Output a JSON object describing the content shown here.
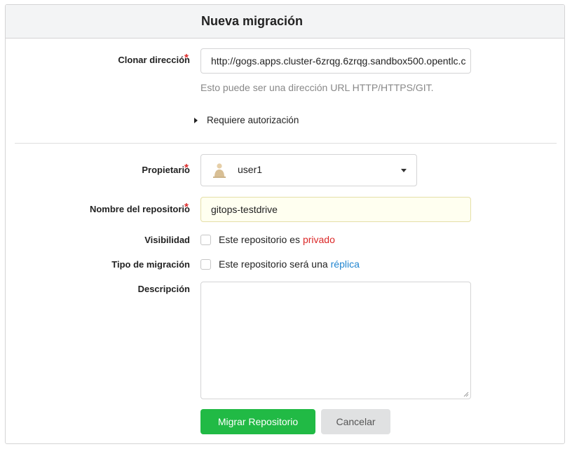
{
  "header": {
    "title": "Nueva migración"
  },
  "form": {
    "clone": {
      "label": "Clonar dirección",
      "required_mark": "*",
      "value": "http://gogs.apps.cluster-6zrqg.6zrqg.sandbox500.opentlc.c",
      "help": "Esto puede ser una dirección URL HTTP/HTTPS/GIT."
    },
    "auth_toggle": "Requiere autorización",
    "owner": {
      "label": "Propietario",
      "required_mark": "*",
      "value": "user1"
    },
    "repo_name": {
      "label": "Nombre del repositorio",
      "required_mark": "*",
      "value": "gitops-testdrive"
    },
    "visibility": {
      "label": "Visibilidad",
      "text": "Este repositorio es",
      "highlight": "privado",
      "checked": false
    },
    "migration_type": {
      "label": "Tipo de migración",
      "text": "Este repositorio será una",
      "highlight": "réplica",
      "checked": false
    },
    "description": {
      "label": "Descripción",
      "value": ""
    }
  },
  "buttons": {
    "submit": "Migrar Repositorio",
    "cancel": "Cancelar"
  },
  "colors": {
    "accent_green": "#21ba45",
    "required_red": "#db2828",
    "link_blue": "#2185d0",
    "autofill_bg": "#fffff0"
  }
}
